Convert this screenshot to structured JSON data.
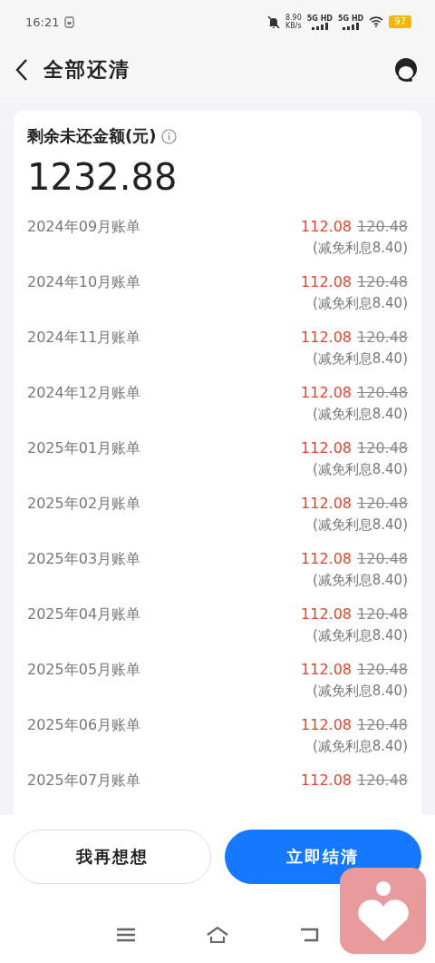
{
  "status_bar": {
    "time": "16:21",
    "speed": "8.90",
    "speed_unit": "KB/s",
    "networks": [
      "5G HD",
      "5G HD"
    ],
    "battery": "97"
  },
  "header": {
    "title": "全部还清"
  },
  "summary": {
    "label": "剩余未还金额(元)",
    "amount": "1232.88"
  },
  "bills": [
    {
      "label": "2024年09月账单",
      "amount": "112.08",
      "original": "120.48",
      "note": "(减免利息8.40)"
    },
    {
      "label": "2024年10月账单",
      "amount": "112.08",
      "original": "120.48",
      "note": "(减免利息8.40)"
    },
    {
      "label": "2024年11月账单",
      "amount": "112.08",
      "original": "120.48",
      "note": "(减免利息8.40)"
    },
    {
      "label": "2024年12月账单",
      "amount": "112.08",
      "original": "120.48",
      "note": "(减免利息8.40)"
    },
    {
      "label": "2025年01月账单",
      "amount": "112.08",
      "original": "120.48",
      "note": "(减免利息8.40)"
    },
    {
      "label": "2025年02月账单",
      "amount": "112.08",
      "original": "120.48",
      "note": "(减免利息8.40)"
    },
    {
      "label": "2025年03月账单",
      "amount": "112.08",
      "original": "120.48",
      "note": "(减免利息8.40)"
    },
    {
      "label": "2025年04月账单",
      "amount": "112.08",
      "original": "120.48",
      "note": "(减免利息8.40)"
    },
    {
      "label": "2025年05月账单",
      "amount": "112.08",
      "original": "120.48",
      "note": "(减免利息8.40)"
    },
    {
      "label": "2025年06月账单",
      "amount": "112.08",
      "original": "120.48",
      "note": "(减免利息8.40)"
    },
    {
      "label": "2025年07月账单",
      "amount": "112.08",
      "original": "120.48"
    }
  ],
  "buttons": [
    {
      "label": "我再想想",
      "kind": "secondary"
    },
    {
      "label": "立即结清",
      "kind": "primary"
    }
  ]
}
